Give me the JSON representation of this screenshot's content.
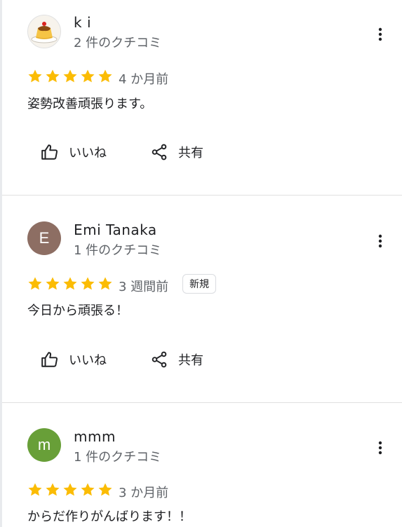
{
  "reviews": [
    {
      "name": "k i",
      "review_count": "2 件のクチコミ",
      "avatar_initial": "",
      "avatar_color": "",
      "rating": 5,
      "time": "4 か月前",
      "badge": "",
      "text": "姿勢改善頑張ります。",
      "like_label": "いいね",
      "share_label": "共有"
    },
    {
      "name": "Emi Tanaka",
      "review_count": "1 件のクチコミ",
      "avatar_initial": "E",
      "avatar_color": "#8d6e63",
      "rating": 5,
      "time": "3 週間前",
      "badge": "新規",
      "text": "今日から頑張る！",
      "like_label": "いいね",
      "share_label": "共有"
    },
    {
      "name": "mmm",
      "review_count": "1 件のクチコミ",
      "avatar_initial": "m",
      "avatar_color": "#689f38",
      "rating": 5,
      "time": "3 か月前",
      "badge": "",
      "text": "からだ作りがんばります！！",
      "like_label": "",
      "share_label": ""
    }
  ],
  "colors": {
    "star": "#fbbc04",
    "text_primary": "#202124",
    "text_secondary": "#5f6368"
  },
  "icons": {
    "avatar_photo": "pudding-icon",
    "menu": "more-vert-icon",
    "like": "thumb-up-icon",
    "share": "share-icon",
    "rating": "star-icon"
  }
}
